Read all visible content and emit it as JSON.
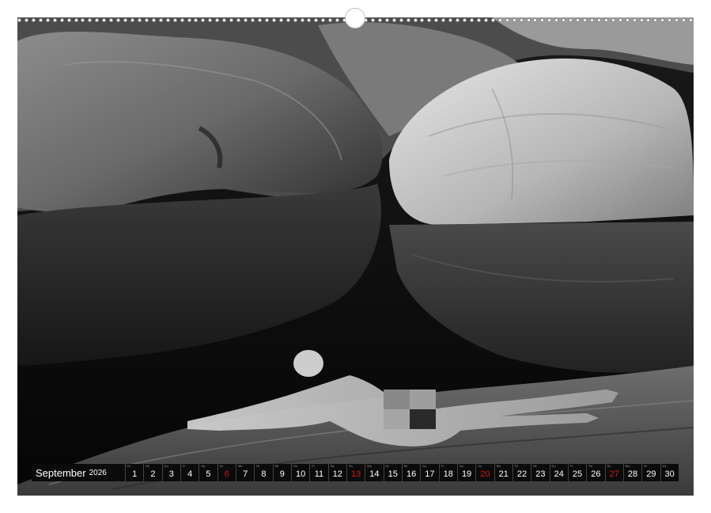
{
  "calendar": {
    "month": "September",
    "year": "2026",
    "days": [
      {
        "dow": "Di",
        "num": "1",
        "sunday": false
      },
      {
        "dow": "Mi",
        "num": "2",
        "sunday": false
      },
      {
        "dow": "Do",
        "num": "3",
        "sunday": false
      },
      {
        "dow": "Fr",
        "num": "4",
        "sunday": false
      },
      {
        "dow": "Sa",
        "num": "5",
        "sunday": false
      },
      {
        "dow": "So",
        "num": "6",
        "sunday": true
      },
      {
        "dow": "Mo",
        "num": "7",
        "sunday": false
      },
      {
        "dow": "Di",
        "num": "8",
        "sunday": false
      },
      {
        "dow": "Mi",
        "num": "9",
        "sunday": false
      },
      {
        "dow": "Do",
        "num": "10",
        "sunday": false
      },
      {
        "dow": "Fr",
        "num": "11",
        "sunday": false
      },
      {
        "dow": "Sa",
        "num": "12",
        "sunday": false
      },
      {
        "dow": "So",
        "num": "13",
        "sunday": true
      },
      {
        "dow": "Mo",
        "num": "14",
        "sunday": false
      },
      {
        "dow": "Di",
        "num": "15",
        "sunday": false
      },
      {
        "dow": "Mi",
        "num": "16",
        "sunday": false
      },
      {
        "dow": "Do",
        "num": "17",
        "sunday": false
      },
      {
        "dow": "Fr",
        "num": "18",
        "sunday": false
      },
      {
        "dow": "Sa",
        "num": "19",
        "sunday": false
      },
      {
        "dow": "So",
        "num": "20",
        "sunday": true
      },
      {
        "dow": "Mo",
        "num": "21",
        "sunday": false
      },
      {
        "dow": "Di",
        "num": "22",
        "sunday": false
      },
      {
        "dow": "Mi",
        "num": "23",
        "sunday": false
      },
      {
        "dow": "Do",
        "num": "24",
        "sunday": false
      },
      {
        "dow": "Fr",
        "num": "25",
        "sunday": false
      },
      {
        "dow": "Sa",
        "num": "26",
        "sunday": false
      },
      {
        "dow": "So",
        "num": "27",
        "sunday": true
      },
      {
        "dow": "Mo",
        "num": "28",
        "sunday": false
      },
      {
        "dow": "Di",
        "num": "29",
        "sunday": false
      },
      {
        "dow": "Mi",
        "num": "30",
        "sunday": false
      }
    ]
  },
  "colors": {
    "sunday": "#d11a1a",
    "strip_bg": "#0b0b0b",
    "text": "#ffffff"
  }
}
